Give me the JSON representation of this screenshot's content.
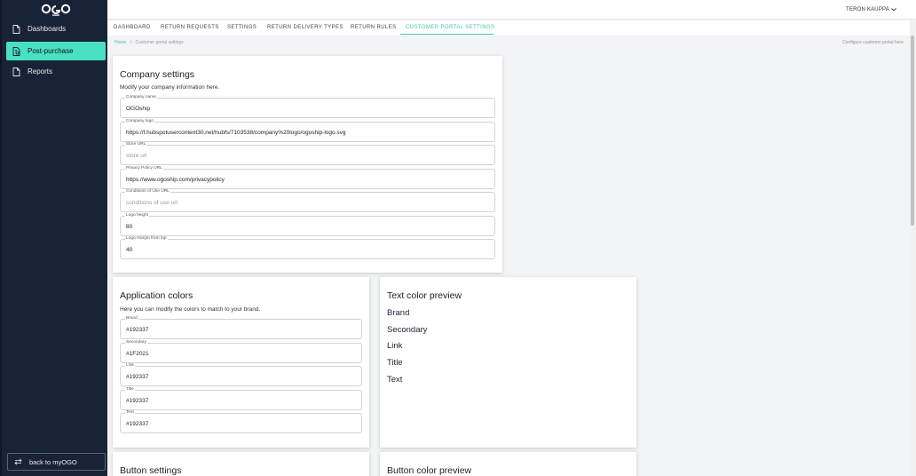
{
  "sidebar": {
    "items": [
      {
        "label": "Dashboards",
        "icon": "document-icon"
      },
      {
        "label": "Post-purchase",
        "icon": "receipt-icon"
      },
      {
        "label": "Reports",
        "icon": "document-icon"
      }
    ],
    "back_label": "back to myOGO"
  },
  "header": {
    "user": "TERON KAUPPA"
  },
  "tabs": [
    "DASHBOARD",
    "RETURN REQUESTS",
    "SETTINGS",
    "RETURN DELIVERY TYPES",
    "RETURN RULES",
    "CUSTOMER PORTAL SETTINGS"
  ],
  "breadcrumb": {
    "home": "Home",
    "sep": "/",
    "current": "Customer portal settings"
  },
  "help_link": "Configure customer portal here",
  "company": {
    "title": "Company settings",
    "subtitle": "Modify your company information here.",
    "fields": [
      {
        "label": "Company name",
        "value": "OGOship",
        "placeholder": ""
      },
      {
        "label": "Company logo",
        "value": "https://f.hubspotusercontent30.net/hubfs/7103538/company%20logo/ogoship-logo.svg",
        "placeholder": ""
      },
      {
        "label": "Store URL",
        "value": "",
        "placeholder": "store url"
      },
      {
        "label": "Privacy Policy URL",
        "value": "https://www.ogoship.com/privacypolicy",
        "placeholder": ""
      },
      {
        "label": "Conditions of Use URL",
        "value": "",
        "placeholder": "conditions of use url"
      },
      {
        "label": "Logo height",
        "value": "80",
        "placeholder": ""
      },
      {
        "label": "Logo margin from top",
        "value": "40",
        "placeholder": ""
      }
    ]
  },
  "app_colors": {
    "title": "Application colors",
    "subtitle": "Here you can modify the colors to match to your brand.",
    "fields": [
      {
        "label": "Brand",
        "value": "#192337"
      },
      {
        "label": "Secondary",
        "value": "#1F2021"
      },
      {
        "label": "Link",
        "value": "#192337"
      },
      {
        "label": "Title",
        "value": "#192337"
      },
      {
        "label": "Text",
        "value": "#192337"
      }
    ]
  },
  "text_preview": {
    "title": "Text color preview",
    "lines": [
      "Brand",
      "Secondary",
      "Link",
      "Title",
      "Text"
    ]
  },
  "button_settings": {
    "title": "Button settings"
  },
  "button_preview": {
    "title": "Button color preview"
  },
  "colors": {
    "sidebar": "#192337",
    "accent": "#49e0c3",
    "tab_active": "#3fc7b0"
  }
}
